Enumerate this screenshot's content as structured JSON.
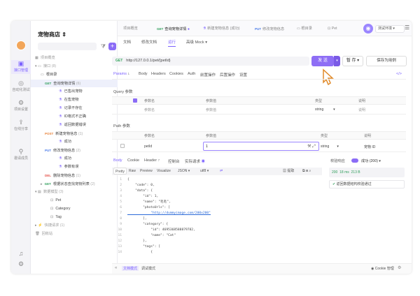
{
  "project": {
    "title": "宠物商店"
  },
  "rail": {
    "items": [
      {
        "label": "接口管理",
        "icon": "api-icon"
      },
      {
        "label": "自动化测试",
        "icon": "test-icon"
      },
      {
        "label": "项目设置",
        "icon": "settings-icon"
      },
      {
        "label": "在线分享",
        "icon": "share-icon"
      },
      {
        "label": "邀请成员",
        "icon": "invite-icon"
      }
    ]
  },
  "sidebar": {
    "items": [
      {
        "label": "项目概览",
        "kind": "section"
      },
      {
        "label": "接口",
        "count": "(8)",
        "kind": "folder"
      },
      {
        "label": "根目录",
        "kind": "folder"
      },
      {
        "method": "GET",
        "label": "查询宠物详情",
        "count": "(6)",
        "kind": "api",
        "selected": true
      },
      {
        "label": "已售出宠物",
        "kind": "case"
      },
      {
        "label": "在售宠物",
        "kind": "case"
      },
      {
        "label": "记录不存在",
        "kind": "case"
      },
      {
        "label": "ID格式不正确",
        "kind": "case"
      },
      {
        "label": "返回数据错误",
        "kind": "case"
      },
      {
        "method": "POST",
        "label": "新建宠物信息",
        "count": "(1)",
        "kind": "api"
      },
      {
        "label": "成功",
        "kind": "case"
      },
      {
        "method": "PUT",
        "label": "修改宠物信息",
        "count": "(2)",
        "kind": "api"
      },
      {
        "label": "成功",
        "kind": "case"
      },
      {
        "label": "参数有误",
        "kind": "case"
      },
      {
        "method": "DEL",
        "label": "删除宠物信息",
        "count": "(1)",
        "kind": "api"
      },
      {
        "method": "GET",
        "label": "根据状态查找宠物列表",
        "count": "(2)",
        "kind": "api"
      },
      {
        "label": "数据模型",
        "count": "(3)",
        "kind": "section"
      },
      {
        "label": "Pet",
        "kind": "model"
      },
      {
        "label": "Category",
        "kind": "model"
      },
      {
        "label": "Tag",
        "kind": "model"
      },
      {
        "label": "快捷请求",
        "count": "(1)",
        "kind": "section"
      },
      {
        "label": "回收站",
        "kind": "section"
      }
    ]
  },
  "tabs": [
    {
      "label": "项目概览"
    },
    {
      "method": "GET",
      "label": "查询宠物详情"
    },
    {
      "label": "新建宠物信息 (成功)"
    },
    {
      "method": "PUT",
      "label": "修改宠物信息"
    },
    {
      "label": "根目录"
    },
    {
      "label": "Pet"
    }
  ],
  "env": {
    "label": "测试环境"
  },
  "subtabs": [
    "文档",
    "修改文档",
    "运行",
    "高级 Mock"
  ],
  "request": {
    "method": "GET",
    "url": "http://127.0.0.1/pet/{petId}",
    "send": "发 送",
    "save": "暂 存",
    "save_as": "保存为用例"
  },
  "req_tabs": [
    "Params",
    "Body",
    "Headers",
    "Cookies",
    "Auth",
    "前置操作",
    "后置操作",
    "设置"
  ],
  "req_tabs_count": "1",
  "query": {
    "title": "Query 参数",
    "headers": [
      "参数名",
      "参数值",
      "类型",
      "说明"
    ],
    "row": {
      "name": "参数名",
      "value": "参数值",
      "type": "string",
      "desc": "说明"
    }
  },
  "path": {
    "title": "Path 参数",
    "headers": [
      "参数名",
      "参数值",
      "类型",
      "说明"
    ],
    "row": {
      "name": "petId",
      "value": "1",
      "type": "string",
      "desc": "宠物 ID"
    }
  },
  "response": {
    "tabs": [
      "Body",
      "Cookie",
      "Header",
      "控制台",
      "实际请求"
    ],
    "header_count": "7",
    "formats": [
      "Pretty",
      "Raw",
      "Preview",
      "Visualize"
    ],
    "json": "JSON",
    "encoding": "utf8",
    "extract": "提取",
    "code_lines": [
      "{",
      "    \"code\": 0,",
      "    \"data\": {",
      "        \"id\": 1,",
      "        \"name\": \"毛毛\",",
      "        \"photoUrls\": [",
      "            \"http://dummyimage.com/200x200\"",
      "        ],",
      "        \"category\": {",
      "            \"id\": 4695368588879782,",
      "            \"name\": \"Cat\"",
      "        },",
      "        \"tags\": [",
      "            {"
    ]
  },
  "validate": {
    "label": "校验响应",
    "status": "成功 (200)",
    "code": "200",
    "time": "18 ms",
    "size": "213 B",
    "result": "返回数据结构校验通过"
  },
  "bottom": {
    "mode": "文档模式",
    "debug": "调试模式",
    "cookie": "Cookie 管理"
  }
}
